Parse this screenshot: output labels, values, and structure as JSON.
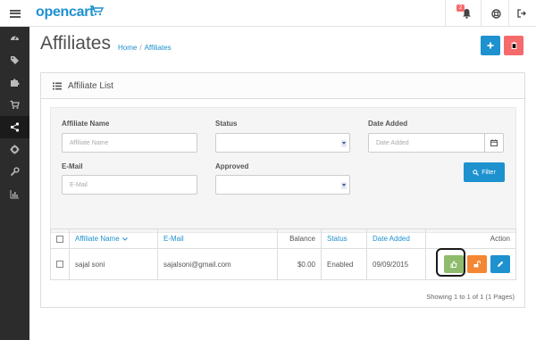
{
  "header": {
    "logo": "opencart",
    "notification_count": "2",
    "icons": [
      "menu-icon",
      "cart-icon",
      "bell-icon",
      "life-ring-icon",
      "sign-out-icon"
    ]
  },
  "sidebar": {
    "items": [
      {
        "icon": "dashboard-icon",
        "active": false
      },
      {
        "icon": "tag-icon",
        "active": false
      },
      {
        "icon": "puzzle-icon",
        "active": false
      },
      {
        "icon": "shopping-cart-icon",
        "active": false
      },
      {
        "icon": "share-icon",
        "active": true
      },
      {
        "icon": "cog-icon",
        "active": false
      },
      {
        "icon": "wrench-icon",
        "active": false
      },
      {
        "icon": "bar-chart-icon",
        "active": false
      }
    ]
  },
  "page": {
    "title": "Affiliates",
    "breadcrumb": {
      "home": "Home",
      "separator": "/",
      "current": "Affiliates"
    }
  },
  "panel": {
    "title": "Affiliate List",
    "filter": {
      "name_label": "Affiliate Name",
      "name_placeholder": "Affiliate Name",
      "status_label": "Status",
      "date_label": "Date Added",
      "date_placeholder": "Date Added",
      "email_label": "E-Mail",
      "email_placeholder": "E-Mail",
      "approved_label": "Approved",
      "filter_button": "Filter"
    },
    "table": {
      "headers": {
        "name": "Affiliate Name",
        "email": "E-Mail",
        "balance": "Balance",
        "status": "Status",
        "date_added": "Date Added",
        "action": "Action"
      },
      "rows": [
        {
          "name": "sajal soni",
          "email": "sajalsoni@gmail.com",
          "balance": "$0.00",
          "status": "Enabled",
          "date_added": "09/09/2015"
        }
      ]
    },
    "pagination": "Showing 1 to 1 of 1 (1 Pages)"
  },
  "colors": {
    "primary": "#1e91cf",
    "danger": "#f56b6b",
    "success": "#8fbb6c",
    "warning": "#f38733",
    "sidebar": "#2c2c2c"
  }
}
